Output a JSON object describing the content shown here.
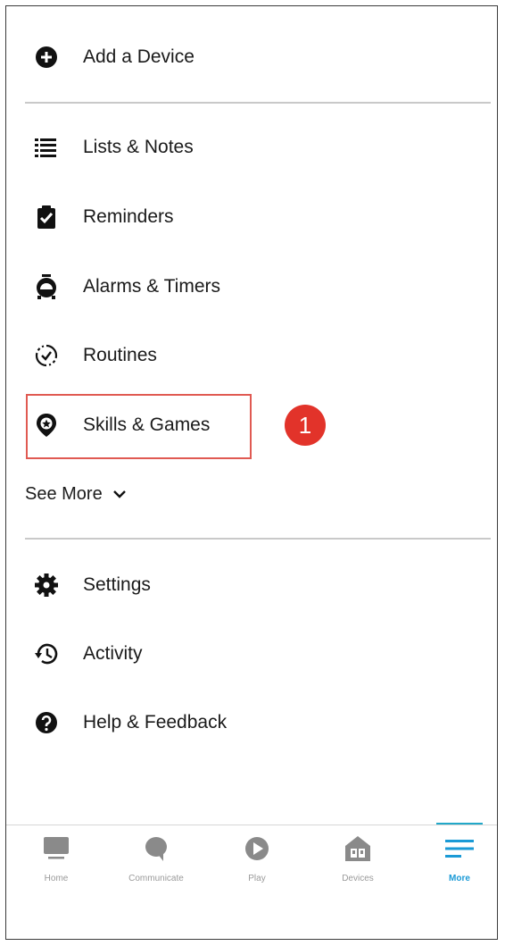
{
  "menu": {
    "add_device": "Add a Device",
    "lists_notes": "Lists & Notes",
    "reminders": "Reminders",
    "alarms_timers": "Alarms & Timers",
    "routines": "Routines",
    "skills_games": "Skills & Games",
    "see_more": "See More",
    "settings": "Settings",
    "activity": "Activity",
    "help_feedback": "Help & Feedback"
  },
  "annotation": {
    "step_number": "1"
  },
  "bottom_nav": {
    "items": [
      {
        "label": "Home",
        "icon": "home-icon"
      },
      {
        "label": "Communicate",
        "icon": "communicate-icon"
      },
      {
        "label": "Play",
        "icon": "play-icon"
      },
      {
        "label": "Devices",
        "icon": "devices-icon"
      },
      {
        "label": "More",
        "icon": "more-icon",
        "active": true
      }
    ]
  },
  "colors": {
    "highlight": "#e05a52",
    "badge": "#e2332a",
    "active_nav": "#1a9ad6"
  }
}
